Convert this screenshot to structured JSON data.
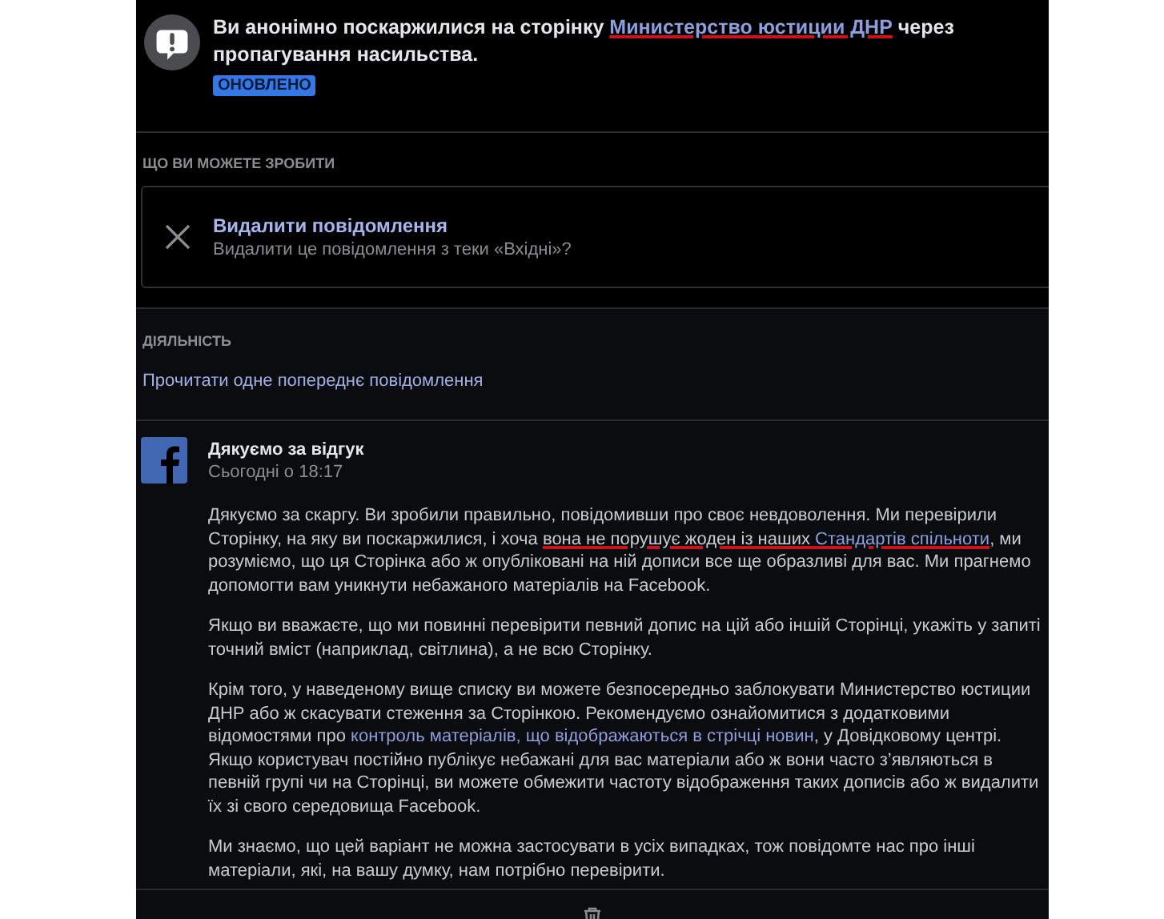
{
  "notice": {
    "parts": [
      {
        "kind": "text",
        "text": "Ви анонімно поскаржилися на сторінку ",
        "underlined": false
      },
      {
        "kind": "link",
        "text": "Министерство юстиции ДНР",
        "underlined": true
      },
      {
        "kind": "text",
        "text": " через пропагування насильства.",
        "underlined": false
      }
    ],
    "badge": "ОНОВЛЕНО"
  },
  "actions": {
    "heading": "ЩО ВИ МОЖЕТЕ ЗРОБИТИ",
    "items": [
      {
        "title": "Видалити повідомлення",
        "subtitle": "Видалити це повідомлення з теки «Вхідні»?"
      }
    ]
  },
  "activity": {
    "heading": "ДІЯЛЬНІСТЬ",
    "link": "Прочитати одне попереднє повідомлення"
  },
  "message": {
    "title": "Дякуємо за відгук",
    "time": "Сьогодні о 18:17",
    "paragraphs": [
      [
        {
          "kind": "text",
          "text": "Дякуємо за скаргу. Ви зробили правильно, повідомивши про своє невдоволення. Ми перевірили Сторінку, на яку ви поскаржилися, і хоча ",
          "underlined": false
        },
        {
          "kind": "text",
          "text": "вона не порушує жоден із наших ",
          "underlined": true
        },
        {
          "kind": "link",
          "text": "Стандартів спільноти",
          "underlined": true
        },
        {
          "kind": "text",
          "text": ", ми розуміємо, що ця Сторінка або ж опубліковані на ній дописи все ще образливі для вас. Ми прагнемо допомогти вам уникнути небажаного матеріалів на Facebook.",
          "underlined": false
        }
      ],
      [
        {
          "kind": "text",
          "text": "Якщо ви вважаєте, що ми повинні перевірити певний допис на цій або іншій Сторінці, укажіть у запиті точний вміст (наприклад, світлина), а не всю Сторінку.",
          "underlined": false
        }
      ],
      [
        {
          "kind": "text",
          "text": "Крім того, у наведеному вище списку ви можете безпосередньо заблокувати Министерство юстиции ДНР або ж скасувати стеження за Сторінкою. Рекомендуємо ознайомитися з додатковими відомостями про ",
          "underlined": false
        },
        {
          "kind": "link",
          "text": "контроль матеріалів, що відображаються в стрічці новин",
          "underlined": false
        },
        {
          "kind": "text",
          "text": ", у Довідковому центрі. Якщо користувач постійно публікує небажані для вас матеріали або ж вони часто з’являються в певній групі чи на Сторінці, ви можете обмежити частоту відображення таких дописів або ж видалити їх зі свого середовища Facebook.",
          "underlined": false
        }
      ],
      [
        {
          "kind": "text",
          "text": "Ми знаємо, що цей варіант не можна застосувати в усіх випадках, тож повідомте нас про інші матеріали, які, на вашу думку, нам потрібно перевірити.",
          "underlined": false
        }
      ]
    ]
  }
}
